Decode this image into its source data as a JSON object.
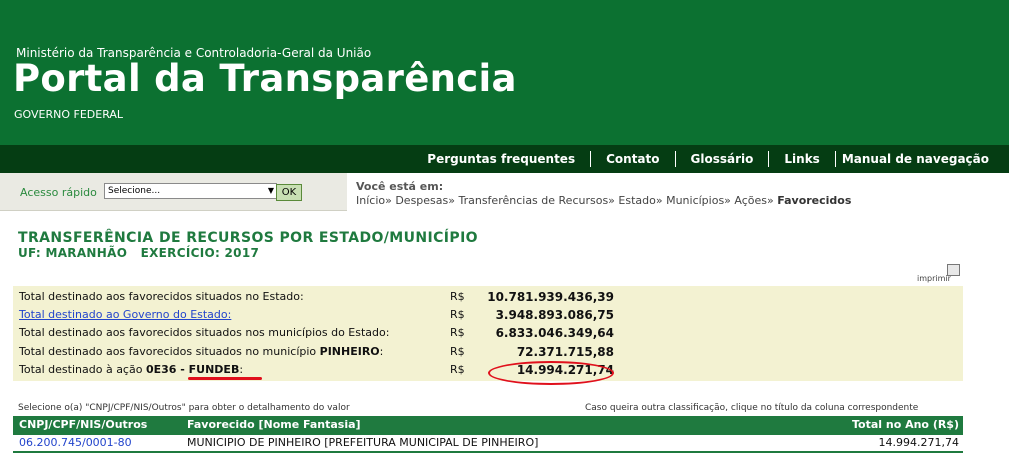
{
  "header": {
    "ministry": "Ministério da Transparência e Controladoria-Geral da União",
    "portal_title": "Portal da Transparência",
    "government": "GOVERNO FEDERAL"
  },
  "nav": {
    "items": [
      {
        "label": "Perguntas frequentes"
      },
      {
        "label": "Contato"
      },
      {
        "label": "Glossário"
      },
      {
        "label": "Links"
      },
      {
        "label": "Manual de navegação"
      }
    ]
  },
  "quick_access": {
    "label": "Acesso rápido",
    "select_value": "Selecione...",
    "ok_label": "OK"
  },
  "breadcrumb": {
    "label": "Você está em:",
    "path": "Início» Despesas» Transferências de Recursos» Estado» Municípios» Ações» ",
    "current": "Favorecidos"
  },
  "page": {
    "title": "TRANSFERÊNCIA DE RECURSOS POR ESTADO/MUNICÍPIO",
    "subtitle": "UF: MARANHÃO   EXERCÍCIO: 2017",
    "print_label": "imprimir"
  },
  "summary": {
    "rows": [
      {
        "label": "Total destinado aos favorecidos situados no Estado:",
        "currency": "R$",
        "value": "10.781.939.436,39"
      },
      {
        "label": "Total destinado ao Governo do Estado:",
        "currency": "R$",
        "value": "3.948.893.086,75"
      },
      {
        "label": "Total destinado aos favorecidos situados nos municípios do Estado:",
        "currency": "R$",
        "value": "6.833.046.349,64"
      },
      {
        "label": "Total destinado aos favorecidos situados no município ",
        "label_bold": "PINHEIRO",
        "label_tail": ":",
        "currency": "R$",
        "value": "72.371.715,88"
      },
      {
        "label": "Total destinado à ação ",
        "label_bold": "0E36 - FUNDEB",
        "label_tail": ":",
        "currency": "R$",
        "value": "14.994.271,74"
      }
    ]
  },
  "hints": {
    "left": "Selecione o(a) \"CNPJ/CPF/NIS/Outros\" para obter o detalhamento do valor",
    "right": "Caso queira outra classificação, clique no título da coluna correspondente"
  },
  "table": {
    "headers": [
      "CNPJ/CPF/NIS/Outros",
      "Favorecido [Nome Fantasia]",
      "Total no Ano (R$)"
    ],
    "rows": [
      {
        "cnpj": "06.200.745/0001-80",
        "name": "MUNICIPIO DE PINHEIRO [PREFEITURA MUNICIPAL DE PINHEIRO]",
        "total": "14.994.271,74"
      }
    ]
  },
  "colors": {
    "header_green": "#0c7131",
    "nav_dark_green": "#053d13",
    "title_green": "#1f7a3f",
    "summary_bg": "#f3f2d2",
    "annotation_red": "#e0101c"
  }
}
